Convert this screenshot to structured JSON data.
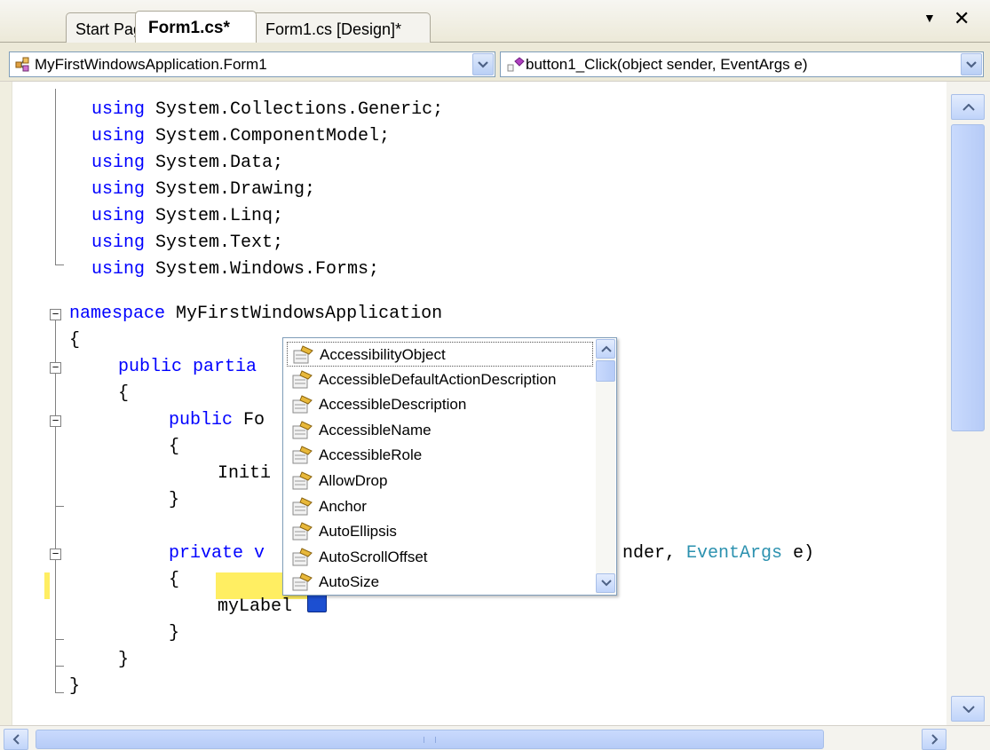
{
  "tabs": [
    {
      "label": "Start Page",
      "active": false
    },
    {
      "label": "Form1.cs*",
      "active": true
    },
    {
      "label": "Form1.cs [Design]*",
      "active": false
    }
  ],
  "window_controls": {
    "dropdown_icon": "triangle-down-icon",
    "close_icon": "close-icon"
  },
  "navbar": {
    "class_combo": "MyFirstWindowsApplication.Form1",
    "member_combo": "button1_Click(object sender, EventArgs e)"
  },
  "code_lines": [
    {
      "kw": "using",
      "rest": " System.Collections.Generic;"
    },
    {
      "kw": "using",
      "rest": " System.ComponentModel;"
    },
    {
      "kw": "using",
      "rest": " System.Data;"
    },
    {
      "kw": "using",
      "rest": " System.Drawing;"
    },
    {
      "kw": "using",
      "rest": " System.Linq;"
    },
    {
      "kw": "using",
      "rest": " System.Text;"
    },
    {
      "kw": "using",
      "rest": " System.Windows.Forms;"
    },
    {
      "kw": "namespace",
      "rest": " MyFirstWindowsApplication"
    },
    {
      "text": "{"
    },
    {
      "kw": "public partia"
    },
    {
      "text": "{"
    },
    {
      "kw": "public",
      "rest": " Fo"
    },
    {
      "text": "{"
    },
    {
      "text": "Initi"
    },
    {
      "text": "}"
    },
    {
      "kw": "private v",
      "rest_right": "nder, ",
      "type_right": "EventArgs",
      "tail_right": " e)"
    },
    {
      "text": "{"
    },
    {
      "text": "myLabel"
    },
    {
      "text": "}"
    },
    {
      "text": "}"
    },
    {
      "text": "}"
    }
  ],
  "completion_list": {
    "items": [
      "AccessibilityObject",
      "AccessibleDefaultActionDescription",
      "AccessibleDescription",
      "AccessibleName",
      "AccessibleRole",
      "AllowDrop",
      "Anchor",
      "AutoEllipsis",
      "AutoScrollOffset",
      "AutoSize"
    ],
    "selected_index": 0,
    "item_icon": "property-icon"
  },
  "colors": {
    "keyword": "#0000ff",
    "type": "#2b91af",
    "highlight": "#ffee62"
  }
}
